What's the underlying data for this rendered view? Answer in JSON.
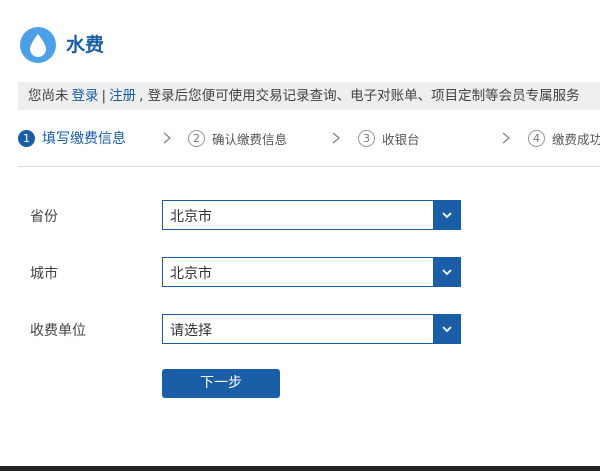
{
  "header": {
    "title": "水费",
    "icon": "water-drop-icon",
    "icon_color": "#4d9fe8"
  },
  "notice": {
    "prefix": "您尚未",
    "login_link": "登录",
    "separator": "|",
    "register_link": "注册",
    "suffix": ", 登录后您便可使用交易记录查询、电子对账单、项目定制等会员专属服务"
  },
  "steps": [
    {
      "number": "1",
      "label": "填写缴费信息",
      "active": true
    },
    {
      "number": "2",
      "label": "确认缴费信息",
      "active": false
    },
    {
      "number": "3",
      "label": "收银台",
      "active": false
    },
    {
      "number": "4",
      "label": "缴费成功",
      "active": false
    }
  ],
  "form": {
    "province": {
      "label": "省份",
      "value": "北京市"
    },
    "city": {
      "label": "城市",
      "value": "北京市"
    },
    "unit": {
      "label": "收费单位",
      "value": "请选择"
    },
    "next_button": "下一步"
  },
  "colors": {
    "accent": "#1a5ea8",
    "notice_bg": "#eeeeee"
  }
}
